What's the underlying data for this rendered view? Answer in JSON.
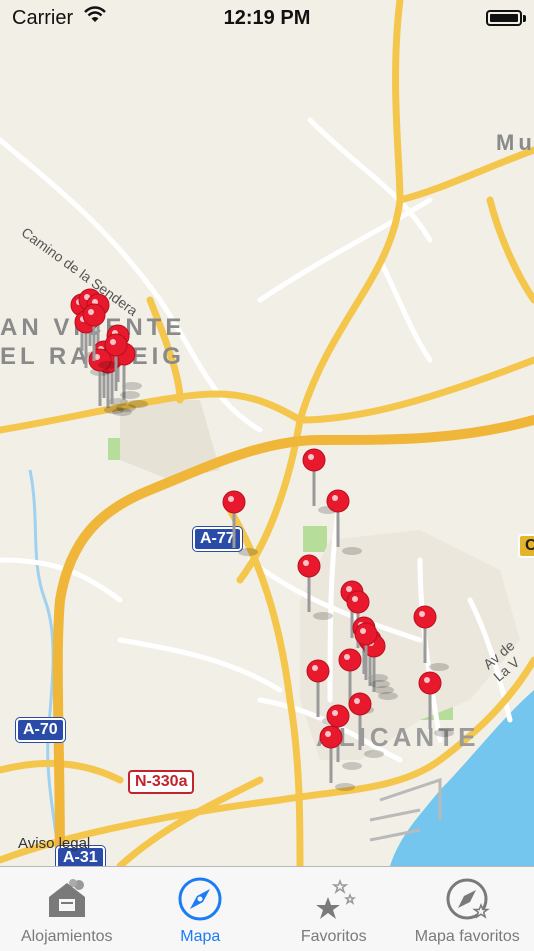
{
  "status_bar": {
    "carrier": "Carrier",
    "time": "12:19 PM"
  },
  "map": {
    "labels": {
      "town": "AN VICENTE",
      "town_line2": "EL RASPEIG",
      "city": "ALICANTE",
      "muchamiel": "Mu",
      "road_sendera": "Camino de la Sendera",
      "road_avla": "Av de La V"
    },
    "shields": {
      "a77": "A-77",
      "a70": "A-70",
      "a31": "A-31",
      "n330a": "N-330a",
      "c_right": "C",
      "a_partial": "A-31"
    },
    "legal": "Aviso legal",
    "pin_count": 29
  },
  "tab_bar": {
    "tabs": [
      {
        "label": "Alojamientos",
        "icon": "house-icon",
        "active": false
      },
      {
        "label": "Mapa",
        "icon": "compass-icon",
        "active": true
      },
      {
        "label": "Favoritos",
        "icon": "stars-icon",
        "active": false
      },
      {
        "label": "Mapa favoritos",
        "icon": "compass-star-icon",
        "active": false
      }
    ]
  },
  "colors": {
    "accent": "#1c7cf4",
    "pin": "#e8192c",
    "sea": "#70c4ee",
    "road_main": "#f4c64c"
  }
}
